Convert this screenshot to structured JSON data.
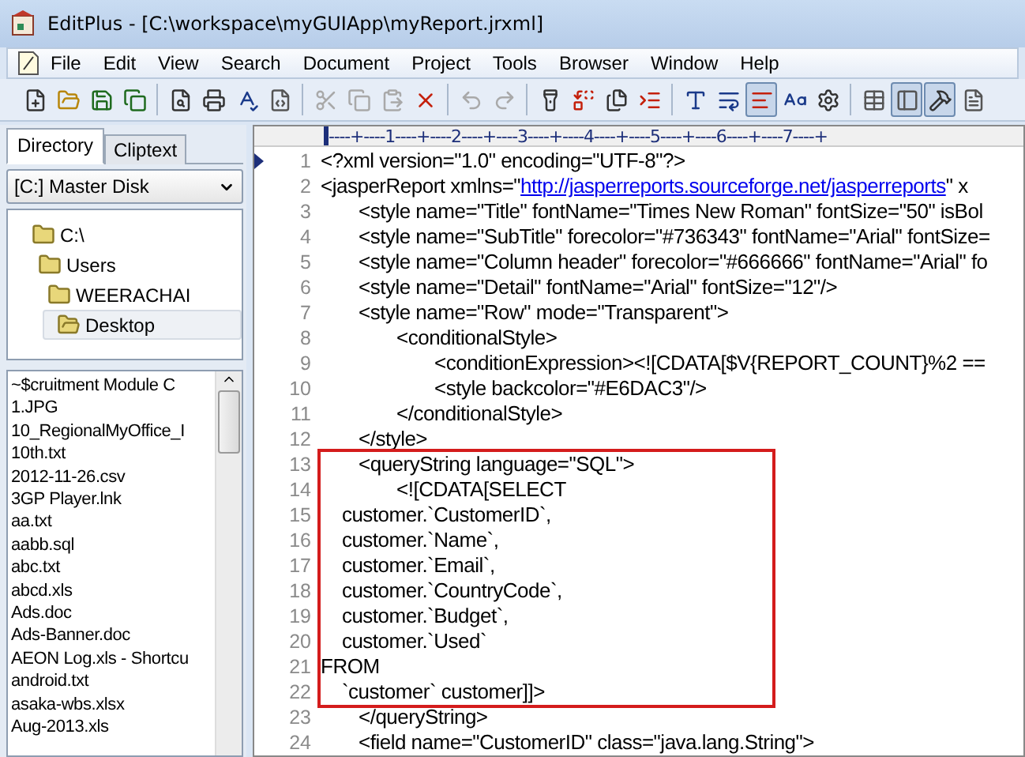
{
  "window": {
    "title": "EditPlus - [C:\\workspace\\myGUIApp\\myReport.jrxml]"
  },
  "menu": [
    "File",
    "Edit",
    "View",
    "Search",
    "Document",
    "Project",
    "Tools",
    "Browser",
    "Window",
    "Help"
  ],
  "toolbar": [
    {
      "kind": "button",
      "disabled": false,
      "pressed": false
    },
    {
      "kind": "button",
      "disabled": false,
      "pressed": false
    },
    {
      "kind": "button",
      "disabled": false,
      "pressed": false
    },
    {
      "kind": "button",
      "disabled": false,
      "pressed": false
    },
    {
      "kind": "separator"
    },
    {
      "kind": "button",
      "disabled": false,
      "pressed": false
    },
    {
      "kind": "button",
      "disabled": false,
      "pressed": false
    },
    {
      "kind": "button",
      "disabled": false,
      "pressed": false
    },
    {
      "kind": "button",
      "disabled": false,
      "pressed": false
    },
    {
      "kind": "separator"
    },
    {
      "kind": "button",
      "disabled": true,
      "pressed": false
    },
    {
      "kind": "button",
      "disabled": true,
      "pressed": false
    },
    {
      "kind": "button",
      "disabled": true,
      "pressed": false
    },
    {
      "kind": "button",
      "disabled": false,
      "pressed": false
    },
    {
      "kind": "separator"
    },
    {
      "kind": "button",
      "disabled": true,
      "pressed": false
    },
    {
      "kind": "button",
      "disabled": true,
      "pressed": false
    },
    {
      "kind": "separator"
    },
    {
      "kind": "button",
      "disabled": false,
      "pressed": false
    },
    {
      "kind": "button",
      "disabled": false,
      "pressed": false
    },
    {
      "kind": "button",
      "disabled": false,
      "pressed": false
    },
    {
      "kind": "button",
      "disabled": false,
      "pressed": false
    },
    {
      "kind": "separator"
    },
    {
      "kind": "button",
      "disabled": false,
      "pressed": false
    },
    {
      "kind": "button",
      "disabled": false,
      "pressed": false
    },
    {
      "kind": "button",
      "disabled": false,
      "pressed": true
    },
    {
      "kind": "button",
      "disabled": false,
      "pressed": false
    },
    {
      "kind": "button",
      "disabled": false,
      "pressed": false
    },
    {
      "kind": "separator"
    },
    {
      "kind": "button",
      "disabled": false,
      "pressed": false
    },
    {
      "kind": "button",
      "disabled": false,
      "pressed": true
    },
    {
      "kind": "button",
      "disabled": false,
      "pressed": true
    },
    {
      "kind": "button",
      "disabled": false,
      "pressed": false
    }
  ],
  "sidebar": {
    "tabs": [
      {
        "label": "Directory",
        "selected": true
      },
      {
        "label": "Cliptext",
        "selected": false
      }
    ],
    "drive": "[C:] Master Disk",
    "tree": [
      {
        "label": "C:\\",
        "selected": false,
        "children": [
          {
            "label": "Users",
            "selected": false,
            "children": [
              {
                "label": "WEERACHAI",
                "selected": false,
                "children": [
                  {
                    "label": "Desktop",
                    "selected": true
                  }
                ]
              }
            ]
          }
        ]
      }
    ],
    "files": [
      "~$cruitment Module C",
      "1.JPG",
      "10_RegionalMyOffice_I",
      "10th.txt",
      "2012-11-26.csv",
      "3GP Player.lnk",
      "aa.txt",
      "aabb.sql",
      "abc.txt",
      "abcd.xls",
      "Ads.doc",
      "Ads-Banner.doc",
      "AEON Log.xls - Shortcu",
      "android.txt",
      "asaka-wbs.xlsx",
      "Aug-2013.xls"
    ]
  },
  "editor": {
    "ruler": "----+----1----+----2----+----3----+----4----+----5----+----6----+----7----+",
    "blocks": [
      {
        "framed": false,
        "lines": [
          {
            "number": "1",
            "current": true,
            "text": "<?xml version=\"1.0\" encoding=\"UTF-8\"?>"
          },
          {
            "number": "2",
            "current": false,
            "text": "<jasperReport xmlns=\"",
            "link": "http://jasperreports.sourceforge.net/jasperreports",
            "after": "\" x"
          },
          {
            "number": "3",
            "current": false,
            "text": "\t<style name=\"Title\" fontName=\"Times New Roman\" fontSize=\"50\" isBol"
          },
          {
            "number": "4",
            "current": false,
            "text": "\t<style name=\"SubTitle\" forecolor=\"#736343\" fontName=\"Arial\" fontSize="
          },
          {
            "number": "5",
            "current": false,
            "text": "\t<style name=\"Column header\" forecolor=\"#666666\" fontName=\"Arial\" fo"
          },
          {
            "number": "6",
            "current": false,
            "text": "\t<style name=\"Detail\" fontName=\"Arial\" fontSize=\"12\"/>"
          },
          {
            "number": "7",
            "current": false,
            "text": "\t<style name=\"Row\" mode=\"Transparent\">"
          },
          {
            "number": "8",
            "current": false,
            "text": "\t\t<conditionalStyle>"
          },
          {
            "number": "9",
            "current": false,
            "text": "\t\t\t<conditionExpression><![CDATA[$V{REPORT_COUNT}%2 =="
          },
          {
            "number": "10",
            "current": false,
            "text": "\t\t\t<style backcolor=\"#E6DAC3\"/>"
          },
          {
            "number": "11",
            "current": false,
            "text": "\t\t</conditionalStyle>"
          },
          {
            "number": "12",
            "current": false,
            "text": "\t</style>"
          }
        ]
      },
      {
        "framed": true,
        "lines": [
          {
            "number": "13",
            "current": false,
            "text": "\t<queryString language=\"SQL\">"
          },
          {
            "number": "14",
            "current": false,
            "text": "\t\t<![CDATA[SELECT"
          },
          {
            "number": "15",
            "current": false,
            "text": "    customer.`CustomerID`,"
          },
          {
            "number": "16",
            "current": false,
            "text": "    customer.`Name`,"
          },
          {
            "number": "17",
            "current": false,
            "text": "    customer.`Email`,"
          },
          {
            "number": "18",
            "current": false,
            "text": "    customer.`CountryCode`,"
          },
          {
            "number": "19",
            "current": false,
            "text": "    customer.`Budget`,"
          },
          {
            "number": "20",
            "current": false,
            "text": "    customer.`Used`"
          },
          {
            "number": "21",
            "current": false,
            "text": "FROM"
          },
          {
            "number": "22",
            "current": false,
            "text": "    `customer` customer]]>"
          }
        ]
      },
      {
        "framed": false,
        "lines": [
          {
            "number": "23",
            "current": false,
            "text": "\t</queryString>"
          },
          {
            "number": "24",
            "current": false,
            "text": "\t<field name=\"CustomerID\" class=\"java.lang.String\">"
          }
        ]
      }
    ]
  }
}
